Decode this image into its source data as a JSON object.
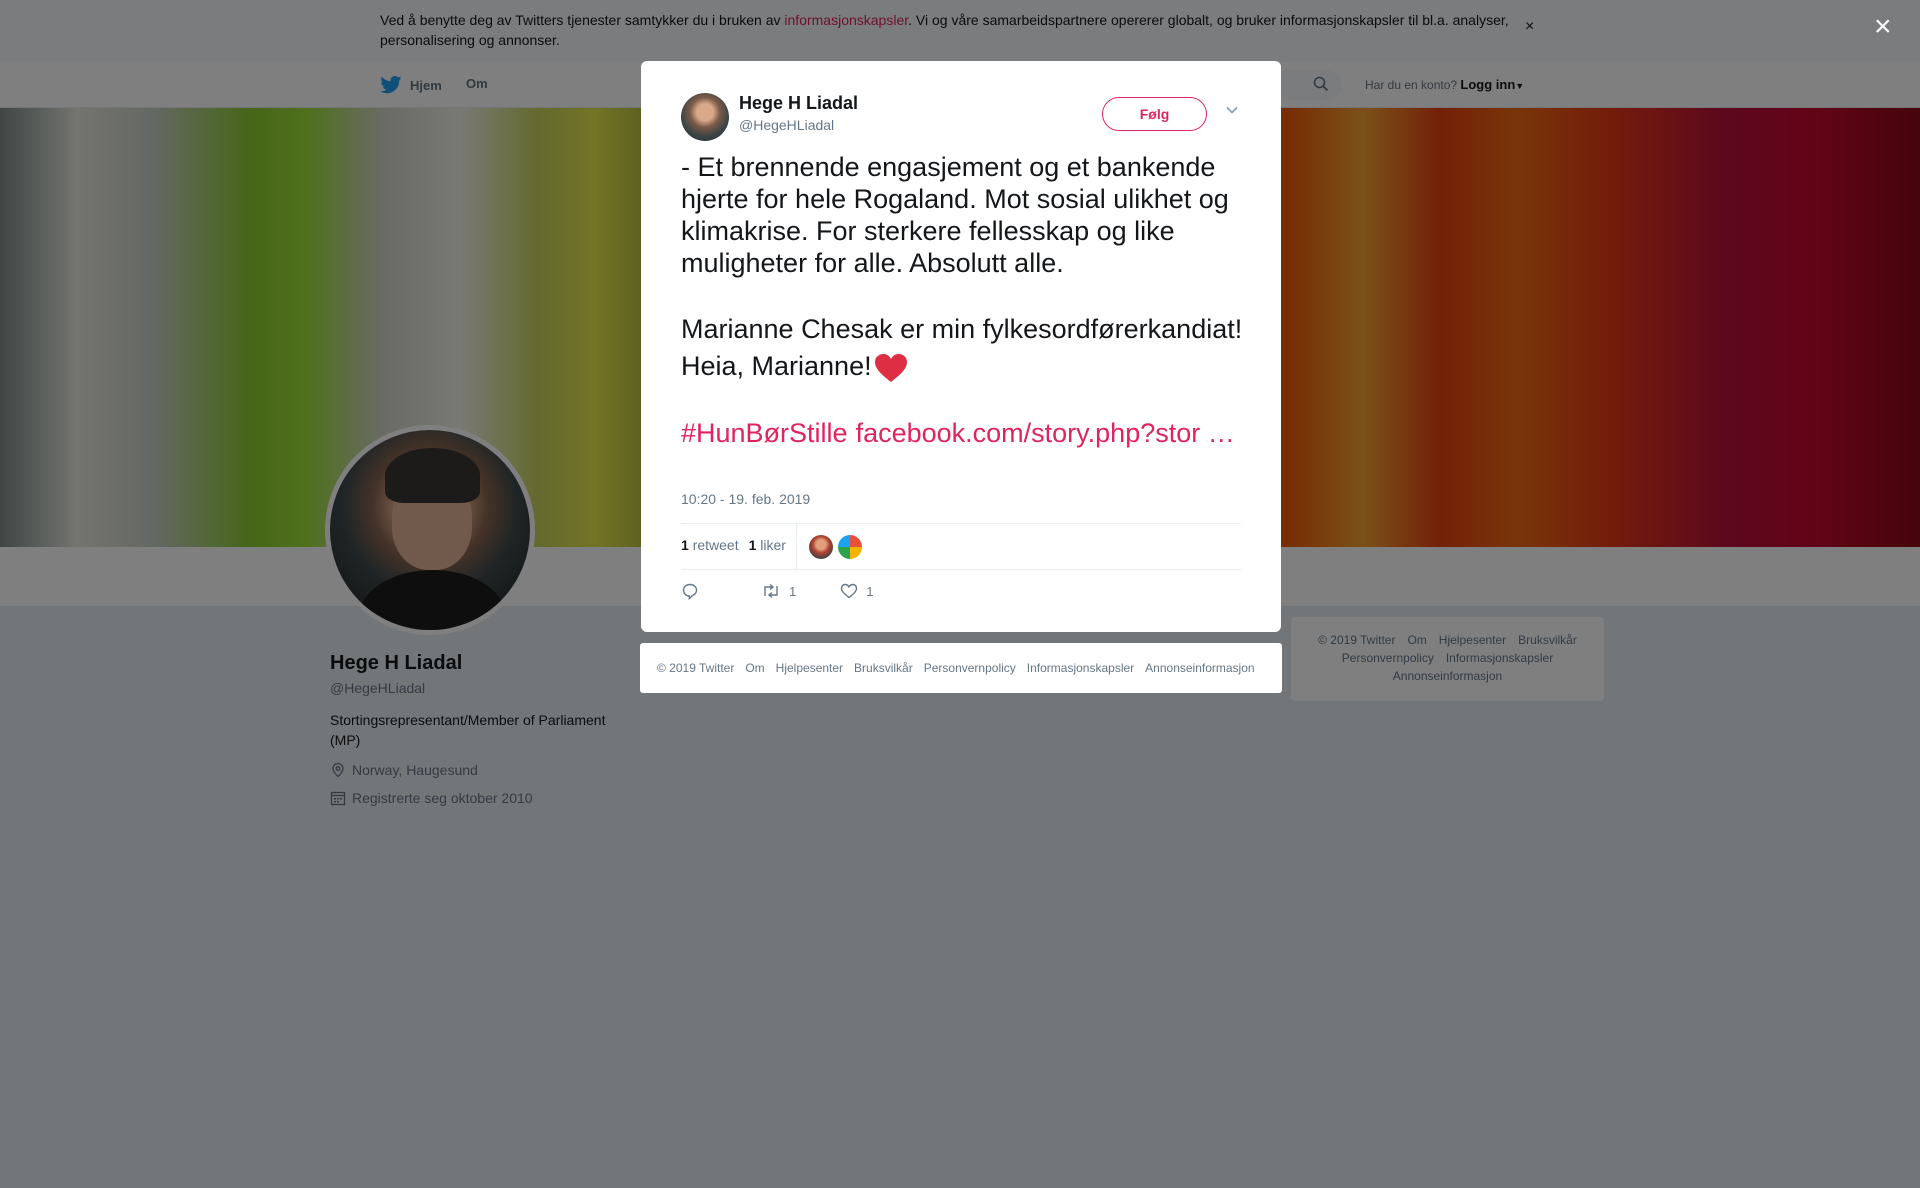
{
  "cookie_banner": {
    "text_before": "Ved å benytte deg av Twitters tjenester samtykker du i bruken av ",
    "link": "informasjonskapsler",
    "text_after": ". Vi og våre samarbeidspartnere opererer globalt, og bruker informasjonskapsler til bl.a. analyser, personalisering og annonser.",
    "close": "×"
  },
  "nav": {
    "home": "Hjem",
    "about": "Om",
    "login_prompt": "Har du en konto?",
    "login": "Logg inn"
  },
  "profile": {
    "name": "Hege H Liadal",
    "handle": "@HegeHLiadal",
    "bio": "Stortingsrepresentant/Member of Parliament (MP)",
    "location": "Norway, Haugesund",
    "joined": "Registrerte seg oktober 2010"
  },
  "side_footer": {
    "items": [
      "© 2019 Twitter",
      "Om",
      "Hjelpesenter",
      "Bruksvilkår",
      "Personvernpolicy",
      "Informasjonskapsler",
      "Annonseinformasjon"
    ]
  },
  "overlay": {
    "close": "×"
  },
  "tweet": {
    "author_name": "Hege H Liadal",
    "author_handle": "@HegeHLiadal",
    "follow_label": "Følg",
    "paragraph1": "- Et brennende engasjement og et bankende hjerte for hele Rogaland. Mot sosial ulikhet og klimakrise. For sterkere fellesskap og like muligheter for alle. Absolutt alle.",
    "paragraph2": "Marianne Chesak er min fylkesordførerkandiat! Heia, Marianne!",
    "hashtag": "#HunBørStille",
    "link": "facebook.com/story.php?stor …",
    "timestamp": "10:20 - 19. feb. 2019",
    "retweet_count": "1",
    "retweet_label": "retweet",
    "like_count": "1",
    "like_label": "liker",
    "action_retweet_count": "1",
    "action_like_count": "1",
    "heart_color": "#e0245e"
  },
  "modal_footer": {
    "items": [
      "© 2019 Twitter",
      "Om",
      "Hjelpesenter",
      "Bruksvilkår",
      "Personvernpolicy",
      "Informasjonskapsler",
      "Annonseinformasjon"
    ]
  }
}
